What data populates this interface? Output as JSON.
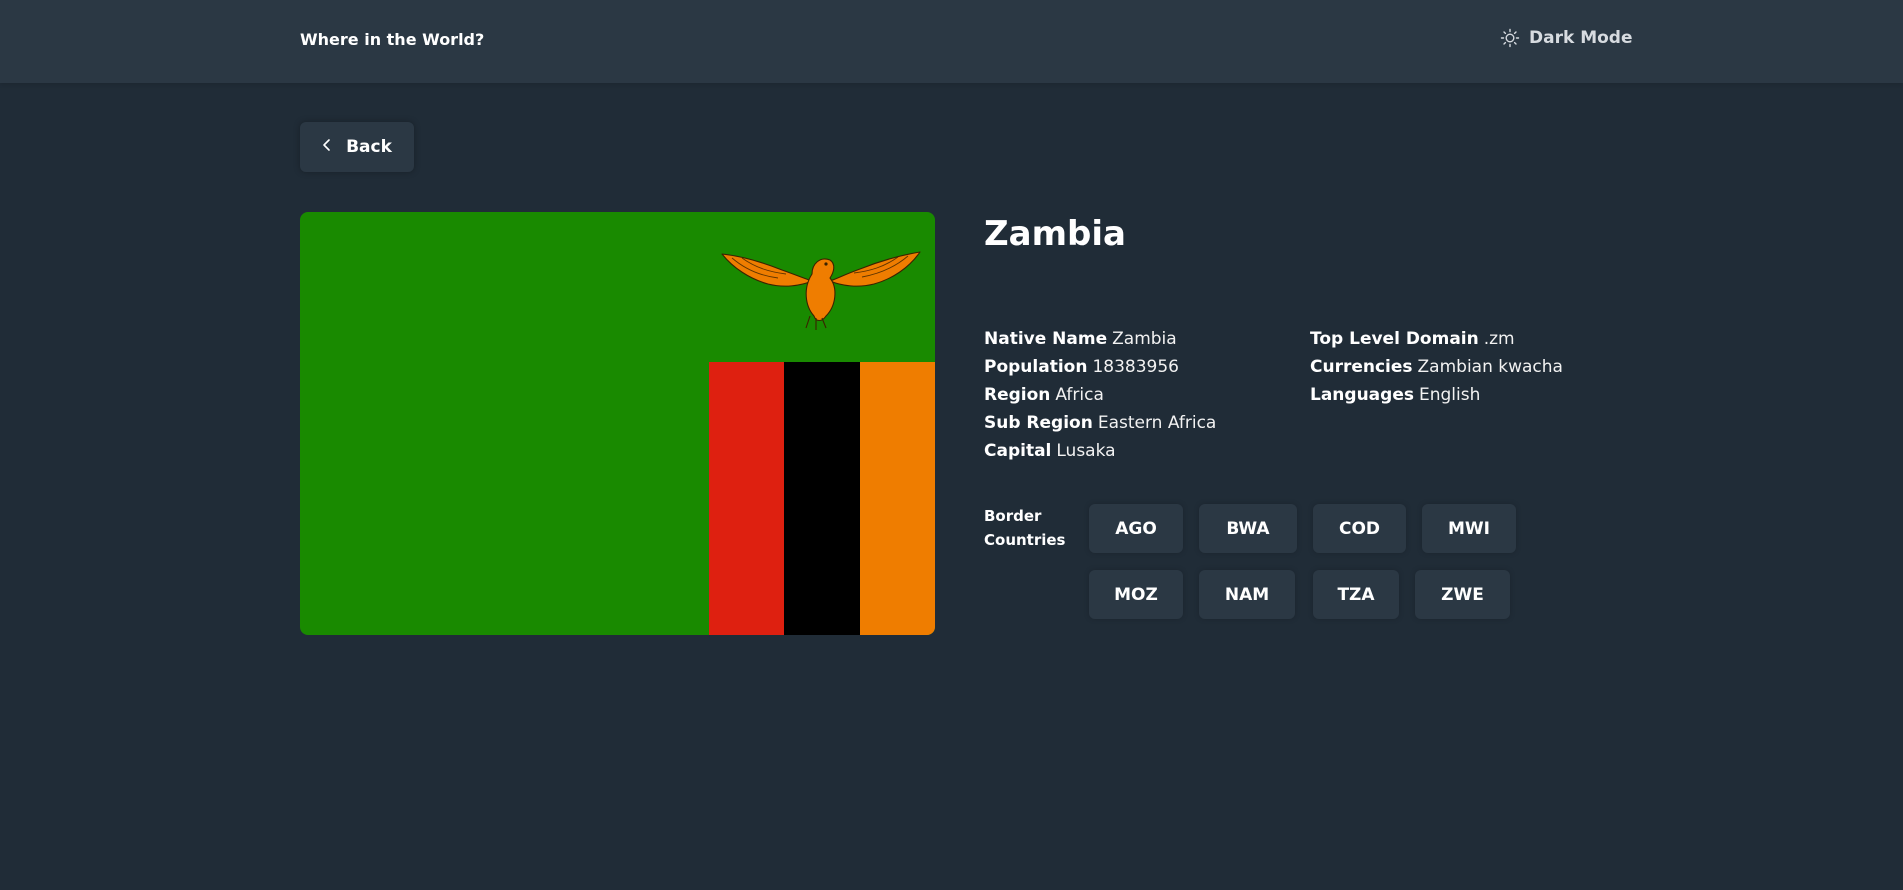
{
  "header": {
    "app_title": "Where in the World?",
    "mode_toggle_label": "Dark Mode",
    "mode_icon": "sun-icon"
  },
  "back_button": {
    "label": "Back",
    "icon": "chevron-left-icon"
  },
  "flag": {
    "alt": "Flag of Zambia",
    "icon": "zambia-flag-image",
    "colors": {
      "green": "#198a00",
      "red": "#de2010",
      "black": "#000000",
      "orange": "#ef7d00"
    }
  },
  "country": {
    "name": "Zambia",
    "native_name_label": "Native Name",
    "native_name": "Zambia",
    "population_label": "Population",
    "population": "18383956",
    "region_label": "Region",
    "region": "Africa",
    "sub_region_label": "Sub Region",
    "sub_region": "Eastern Africa",
    "capital_label": "Capital",
    "capital": "Lusaka",
    "tld_label": "Top Level Domain",
    "tld": ".zm",
    "currencies_label": "Currencies",
    "currencies": "Zambian kwacha",
    "languages_label": "Languages",
    "languages": "English"
  },
  "border_countries": {
    "label": "Border Countries",
    "codes": [
      "AGO",
      "BWA",
      "COD",
      "MWI",
      "MOZ",
      "NAM",
      "TZA",
      "ZWE"
    ]
  },
  "colors": {
    "background": "#202c37",
    "surface": "#2b3844",
    "text": "#ffffff"
  }
}
